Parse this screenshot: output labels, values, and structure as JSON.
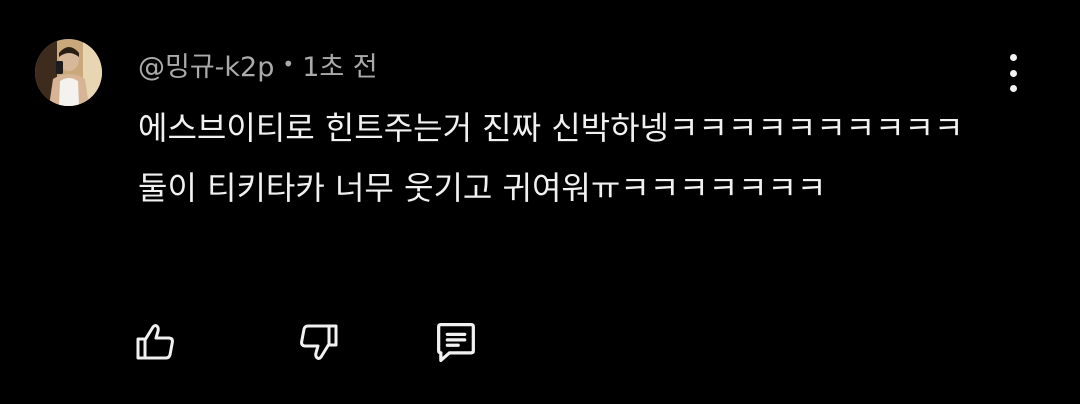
{
  "comment": {
    "author": "@밍규-k2p",
    "separator": "•",
    "time": "1초 전",
    "lines": [
      "에스브이티로 힌트주는거 진짜 신박하넹ㅋㅋㅋㅋㅋㅋㅋㅋㅋㅋ",
      "둘이 티키타카 너무 웃기고 귀여워ㅠㅋㅋㅋㅋㅋㅋㅋ"
    ]
  },
  "icons": {
    "avatar": "avatar",
    "more": "more-vertical-icon",
    "like": "thumbs-up-icon",
    "dislike": "thumbs-down-icon",
    "reply": "comment-icon"
  },
  "colors": {
    "background": "#000000",
    "text": "#f1f1f1",
    "meta": "#aaaaaa"
  }
}
